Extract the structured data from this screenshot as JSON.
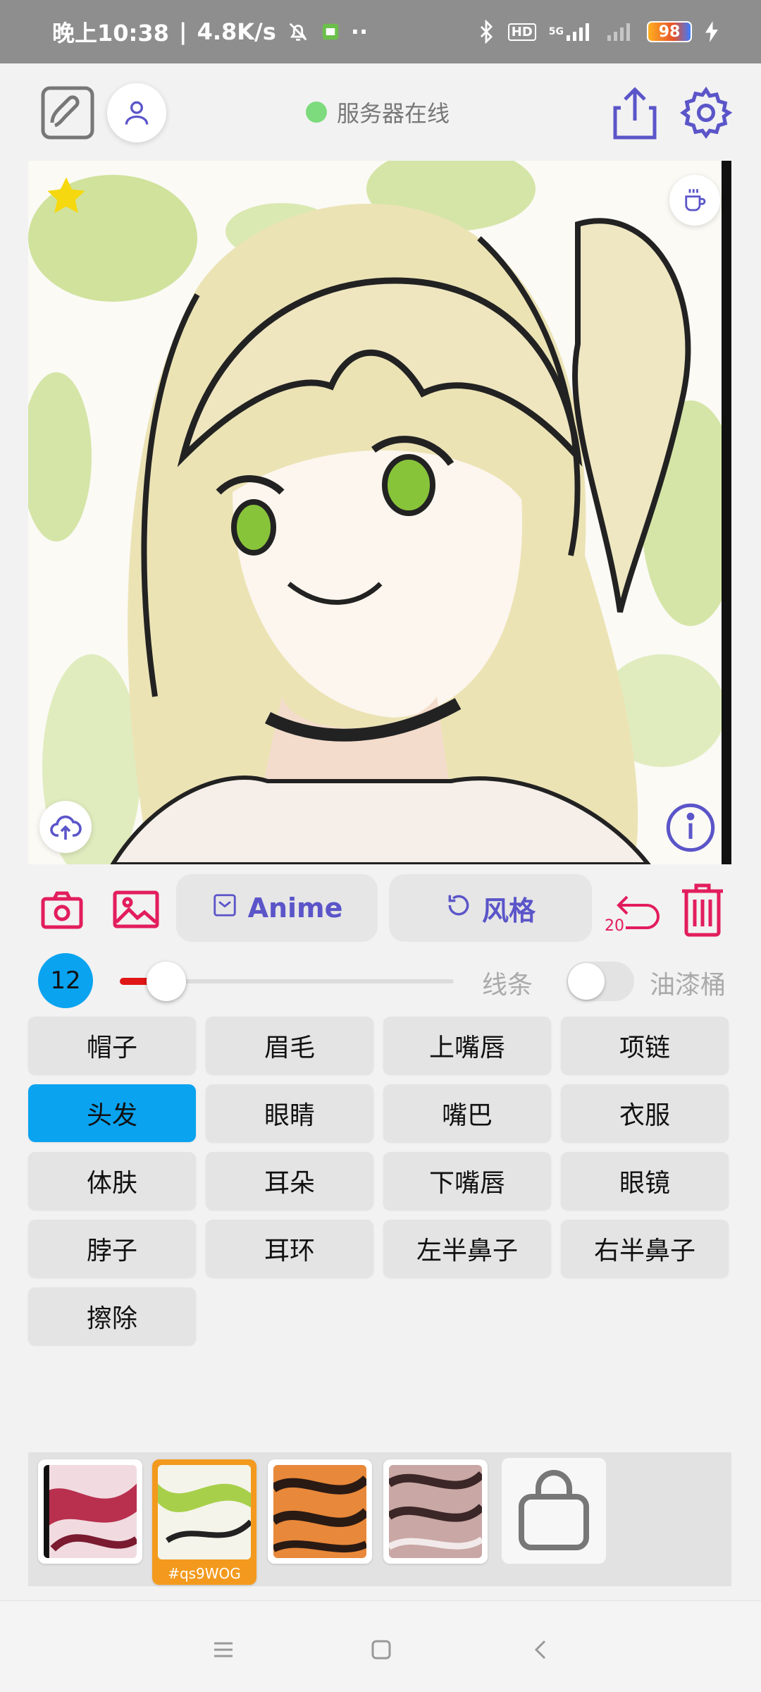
{
  "status_bar": {
    "time": "晚上10:38",
    "speed": "4.8K/s",
    "signal_label": "5G",
    "hd_label": "HD",
    "battery": "98"
  },
  "header": {
    "server_status": "服务器在线",
    "status_color": "#7ddb7d"
  },
  "canvas": {
    "description_icons": [
      "star-icon",
      "coffee-cup-icon",
      "cloud-upload-icon",
      "info-icon"
    ]
  },
  "toolbar": {
    "anime_label": "Anime",
    "style_label": "风格",
    "undo_count": "20",
    "accent_color": "#e21d5d",
    "pill_text_color": "#5b55c9"
  },
  "brush": {
    "size": "12",
    "size_fraction": 0.14,
    "line_label": "线条",
    "bucket_label": "油漆桶",
    "bucket_enabled": false
  },
  "parts": [
    {
      "label": "帽子",
      "active": false
    },
    {
      "label": "眉毛",
      "active": false
    },
    {
      "label": "上嘴唇",
      "active": false
    },
    {
      "label": "项链",
      "active": false
    },
    {
      "label": "头发",
      "active": true
    },
    {
      "label": "眼睛",
      "active": false
    },
    {
      "label": "嘴巴",
      "active": false
    },
    {
      "label": "衣服",
      "active": false
    },
    {
      "label": "体肤",
      "active": false
    },
    {
      "label": "耳朵",
      "active": false
    },
    {
      "label": "下嘴唇",
      "active": false
    },
    {
      "label": "眼镜",
      "active": false
    },
    {
      "label": "脖子",
      "active": false
    },
    {
      "label": "耳环",
      "active": false
    },
    {
      "label": "左半鼻子",
      "active": false
    },
    {
      "label": "右半鼻子",
      "active": false
    },
    {
      "label": "擦除",
      "active": false
    }
  ],
  "styles": {
    "selected_tag": "#qs9WOG"
  },
  "colors": {
    "active_part": "#0aa3f0",
    "slider_fill": "#e01616"
  }
}
